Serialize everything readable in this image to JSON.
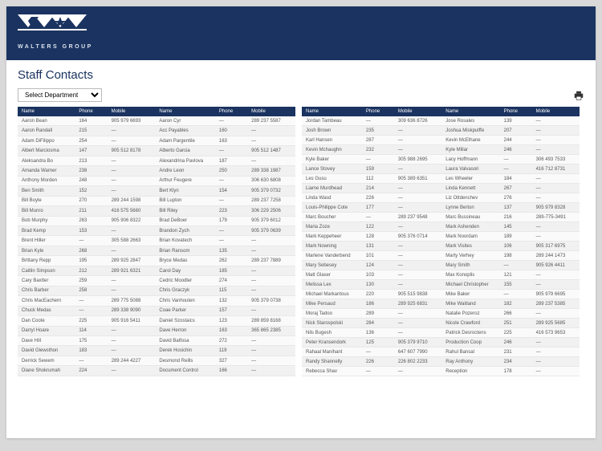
{
  "brand": {
    "name": "WALTERS GROUP"
  },
  "page": {
    "title": "Staff Contacts"
  },
  "toolbar": {
    "dept_label": "Select Department",
    "print_icon": "print-icon"
  },
  "headers": [
    "Name",
    "Phone",
    "Mobile",
    "Name",
    "Phone",
    "Mobile"
  ],
  "left_rows": [
    [
      "Aaron Bean",
      "164",
      "905 979 6693",
      "Aaron Cyr",
      "—",
      "289 237 5587"
    ],
    [
      "Aaron Randall",
      "215",
      "—",
      "Acc Payables",
      "160",
      "—"
    ],
    [
      "Adam DiFilippo",
      "254",
      "—",
      "Adam Pargentile",
      "163",
      "—"
    ],
    [
      "Albert Marciosma",
      "147",
      "905 512 8178",
      "Alberto Garcia",
      "—",
      "905 512 1487"
    ],
    [
      "Aleksandra Bo",
      "213",
      "—",
      "Alexandrina Pavlova",
      "187",
      "—"
    ],
    [
      "Amanda Warner",
      "238",
      "—",
      "Andre Leon",
      "250",
      "289 338 1987"
    ],
    [
      "Anthony Morden",
      "248",
      "—",
      "Arthur Feugere",
      "—",
      "306 630 6808"
    ],
    [
      "Ben Smith",
      "152",
      "—",
      "Bert Klyn",
      "154",
      "905 379 0732"
    ],
    [
      "Bill Boyle",
      "270",
      "289 244 1598",
      "Bill Lupton",
      "—",
      "289 237 7258"
    ],
    [
      "Bill Munro",
      "211",
      "416 575 5660",
      "Bill Riley",
      "223",
      "306 229 2506"
    ],
    [
      "Bob Murphy",
      "263",
      "905 906 8322",
      "Brad DeBoer",
      "179",
      "905 379 6012"
    ],
    [
      "Brad Kemp",
      "153",
      "—",
      "Brandon Zych",
      "—",
      "905 379 0639"
    ],
    [
      "Brent Hiller",
      "—",
      "305 588 2663",
      "Brian Kovatech",
      "—",
      "—"
    ],
    [
      "Brian Kyle",
      "268",
      "—",
      "Brian Ransom",
      "135",
      "—"
    ],
    [
      "Brittany Repp",
      "195",
      "289 925 2847",
      "Bryce Medas",
      "262",
      "289 237 7889"
    ],
    [
      "Caitlin Simpson",
      "212",
      "289 921 6321",
      "Carol Day",
      "185",
      "—"
    ],
    [
      "Cary Baxtter",
      "259",
      "—",
      "Cedric Moodler",
      "274",
      "—"
    ],
    [
      "Chris Barber",
      "258",
      "—",
      "Chris Graczyk",
      "115",
      "—"
    ],
    [
      "Chris MacEachern",
      "—",
      "289 775 5088",
      "Chris Vanhouten",
      "132",
      "905 379 0738"
    ],
    [
      "Chuck Medas",
      "—",
      "289 338 9090",
      "Coae Parker",
      "157",
      "—"
    ],
    [
      "Dan Coote",
      "225",
      "905 916 5411",
      "Daniel Szostaics",
      "123",
      "289 859 8168"
    ],
    [
      "Darryl Hoare",
      "114",
      "—",
      "Dave Herron",
      "163",
      "365 865 2385"
    ],
    [
      "Dave Hill",
      "175",
      "—",
      "David Balfosa",
      "272",
      "—"
    ],
    [
      "David Glewsthon",
      "183",
      "—",
      "Derek Hosichin",
      "119",
      "—"
    ],
    [
      "Derrick Sewem",
      "—",
      "289 244 4227",
      "Desmond Reills",
      "327",
      "—"
    ],
    [
      "Diane Shokrumah",
      "224",
      "—",
      "Document Control",
      "166",
      "—"
    ]
  ],
  "right_rows": [
    [
      "Jordan Tambeau",
      "—",
      "309 636 8726",
      "Jose Rosales",
      "139",
      "—"
    ],
    [
      "Josh Brown",
      "235",
      "—",
      "Joshua Miskpulffe",
      "207",
      "—"
    ],
    [
      "Karl Hansen",
      "287",
      "—",
      "Kevin McElhane",
      "244",
      "—"
    ],
    [
      "Kevin Mchaughn",
      "232",
      "—",
      "Kyle Millar",
      "246",
      "—"
    ],
    [
      "Kyle Baker",
      "—",
      "305 988 2695",
      "Lacy Hoffmann",
      "—",
      "306 493 7533"
    ],
    [
      "Lance Stovey",
      "159",
      "—",
      "Laura Valvasori",
      "—",
      "416 712 8731"
    ],
    [
      "Les Gusu",
      "112",
      "905 389 6351",
      "Les Wheeler",
      "184",
      "—"
    ],
    [
      "Liame Murdhead",
      "214",
      "—",
      "Linda Kennett",
      "267",
      "—"
    ],
    [
      "Linda Wasd",
      "226",
      "—",
      "Liz Ottdenchev",
      "276",
      "—"
    ],
    [
      "Louis-Philippe Cote",
      "177",
      "—",
      "Lynne Berton",
      "137",
      "905 979 8328"
    ],
    [
      "Marc Boucher",
      "—",
      "289 237 9548",
      "Marc Bussineau",
      "216",
      "289-775-3491"
    ],
    [
      "Maria Zoze",
      "122",
      "—",
      "Mark Ashenden",
      "145",
      "—"
    ],
    [
      "Mark Keppeheer",
      "128",
      "905 376 0714",
      "Mark Noordam",
      "189",
      "—"
    ],
    [
      "Mark Nowning",
      "131",
      "—",
      "Mark Visites",
      "106",
      "905 317 6975"
    ],
    [
      "Marlene Vanderbend",
      "101",
      "—",
      "Marty Verhey",
      "198",
      "289 244 1473"
    ],
    [
      "Mary Sebesey",
      "124",
      "—",
      "Mary Smith",
      "—",
      "905 926 4411"
    ],
    [
      "Matt Glaser",
      "103",
      "—",
      "Max Konoplis",
      "121",
      "—"
    ],
    [
      "Melissa Lex",
      "130",
      "—",
      "Michael Christopher",
      "155",
      "—"
    ],
    [
      "Michael Markantous",
      "220",
      "905 515 9838",
      "Mike Baker",
      "—",
      "905 979 6695"
    ],
    [
      "Mike Persaud",
      "186",
      "289 925 6831",
      "Mike Waitland",
      "182",
      "289 237 5385"
    ],
    [
      "Moraj Tadoo",
      "289",
      "—",
      "Natalie Pozeroz",
      "266",
      "—"
    ],
    [
      "Nick Starospolski",
      "284",
      "—",
      "Nicole Crawford",
      "251",
      "289 925 5685"
    ],
    [
      "Nils Bugesh",
      "136",
      "—",
      "Patrick Desroctens",
      "225",
      "416 573 9653"
    ],
    [
      "Peter Kransendork",
      "125",
      "905 379 9710",
      "Production Coop",
      "246",
      "—"
    ],
    [
      "Rahaal Manihant",
      "—",
      "647 607 7990",
      "Rahul Bansal",
      "231",
      "—"
    ],
    [
      "Randy Shannelly",
      "226",
      "226 802 2233",
      "Ray Anthony",
      "234",
      "—"
    ],
    [
      "Rebecca Shav",
      "—",
      "—",
      "Reception",
      "178",
      "—"
    ]
  ]
}
